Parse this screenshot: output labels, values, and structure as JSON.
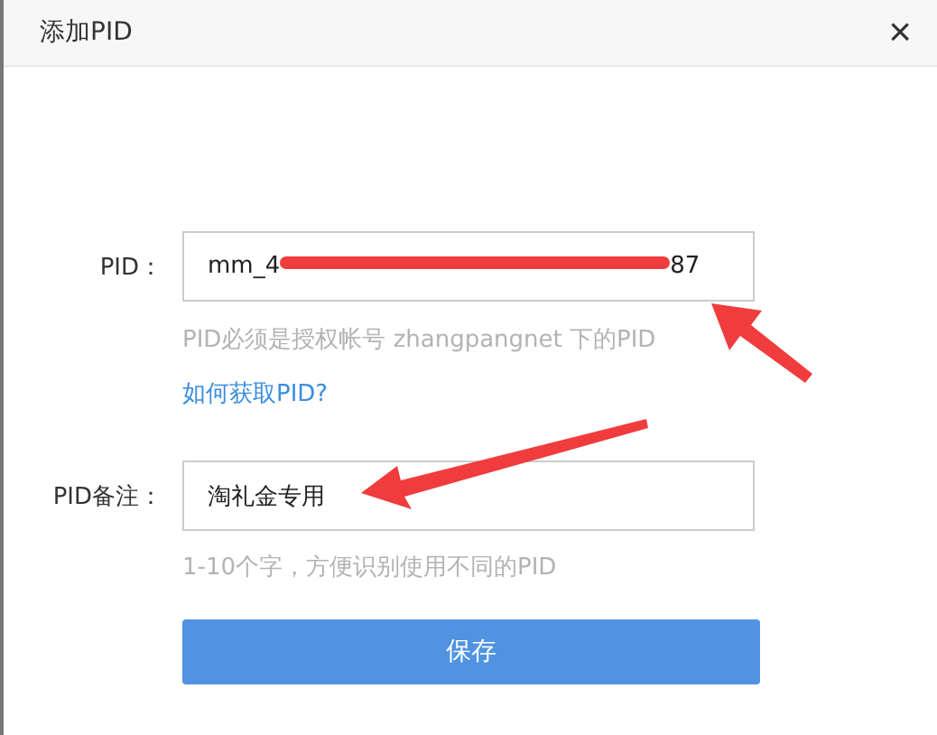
{
  "dialog": {
    "title": "添加PID",
    "close": "×"
  },
  "pid_field": {
    "label": "PID：",
    "value_start": "mm_4",
    "value_end": "87",
    "redacted": true,
    "hint": "PID必须是授权帐号 zhangpangnet 下的PID",
    "link": "如何获取PID?"
  },
  "note_field": {
    "label": "PID备注：",
    "value": "淘礼金专用",
    "hint": "1-10个字，方便识别使用不同的PID"
  },
  "save_button": "保存",
  "annotations": [
    {
      "kind": "arrow",
      "color": "#f03c3c"
    },
    {
      "kind": "arrow",
      "color": "#f03c3c"
    }
  ]
}
